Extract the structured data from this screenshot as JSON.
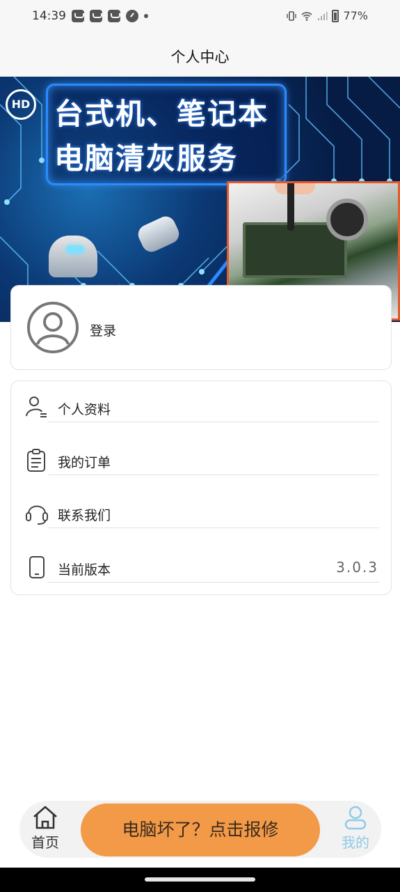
{
  "status_bar": {
    "time": "14:39",
    "battery": "77%",
    "notification_icons": [
      "mail-icon",
      "mail-icon",
      "mail-icon",
      "gauge-icon",
      "dot-icon"
    ],
    "system_icons": [
      "vibrate-icon",
      "wifi-icon",
      "signal-icon",
      "battery-icon"
    ]
  },
  "header": {
    "title": "个人中心"
  },
  "banner": {
    "line1": "台式机、笔记本",
    "line2": "电脑清灰服务",
    "logo": "HD"
  },
  "profile": {
    "login_label": "登录",
    "icon": "avatar-icon"
  },
  "menu": {
    "items": [
      {
        "label": "个人资料",
        "icon": "profile-icon"
      },
      {
        "label": "我的订单",
        "icon": "clipboard-icon"
      },
      {
        "label": "联系我们",
        "icon": "headset-icon"
      },
      {
        "label": "当前版本",
        "icon": "phone-icon",
        "value": "3.0.3"
      }
    ]
  },
  "bottom_nav": {
    "home_label": "首页",
    "cta_label": "电脑坏了？点击报修",
    "mine_label": "我的",
    "active": "mine",
    "colors": {
      "cta": "#f39a48",
      "active": "#8ecae6"
    }
  }
}
